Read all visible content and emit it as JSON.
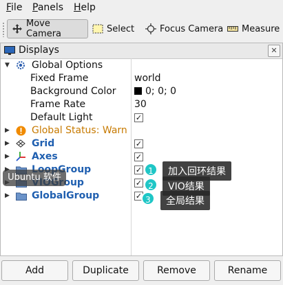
{
  "menubar": {
    "items": [
      {
        "label": "File",
        "mnemonic": "F",
        "rest": "ile"
      },
      {
        "label": "Panels",
        "mnemonic": "P",
        "rest": "anels"
      },
      {
        "label": "Help",
        "mnemonic": "H",
        "rest": "elp"
      }
    ]
  },
  "toolbar": {
    "move_camera": "Move Camera",
    "select": "Select",
    "focus_camera": "Focus Camera",
    "measure": "Measure"
  },
  "displays_panel": {
    "title": "Displays",
    "close_glyph": "✕",
    "global_options": {
      "label": "Global Options",
      "fixed_frame_label": "Fixed Frame",
      "fixed_frame_value": "world",
      "background_color_label": "Background Color",
      "background_color_value": "0; 0; 0",
      "frame_rate_label": "Frame Rate",
      "frame_rate_value": "30",
      "default_light_label": "Default Light",
      "default_light_checked": true
    },
    "global_status": {
      "label": "Global Status: Warn",
      "color": "#c77a00"
    },
    "displays": [
      {
        "label": "Grid",
        "checked": true
      },
      {
        "label": "Axes",
        "checked": true
      },
      {
        "label": "LoopGroup",
        "checked": true
      },
      {
        "label": "VIOGroup",
        "checked": true
      },
      {
        "label": "GlobalGroup",
        "checked": true
      }
    ],
    "check_glyph": "✓"
  },
  "annotations": [
    {
      "number": "1",
      "text": "加入回环结果"
    },
    {
      "number": "2",
      "text": "VIO结果"
    },
    {
      "number": "3",
      "text": "全局结果"
    }
  ],
  "ubuntu_tooltip": "Ubuntu 软件",
  "buttons": {
    "add": "Add",
    "duplicate": "Duplicate",
    "remove": "Remove",
    "rename": "Rename"
  },
  "colors": {
    "accent_teal": "#1fc6c6",
    "link_blue": "#1f5fb0"
  }
}
